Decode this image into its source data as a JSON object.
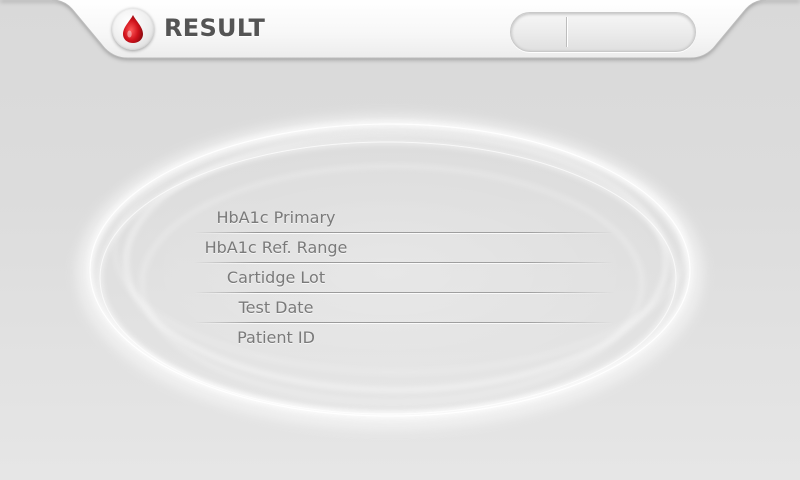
{
  "header": {
    "title": "RESULT",
    "icon": "blood-drop-icon",
    "accent_color": "#d0121b"
  },
  "result_rows": [
    {
      "label": "HbA1c Primary",
      "value": ""
    },
    {
      "label": "HbA1c Ref. Range",
      "value": ""
    },
    {
      "label": "Cartidge Lot",
      "value": ""
    },
    {
      "label": "Test Date",
      "value": ""
    },
    {
      "label": "Patient ID",
      "value": ""
    }
  ]
}
